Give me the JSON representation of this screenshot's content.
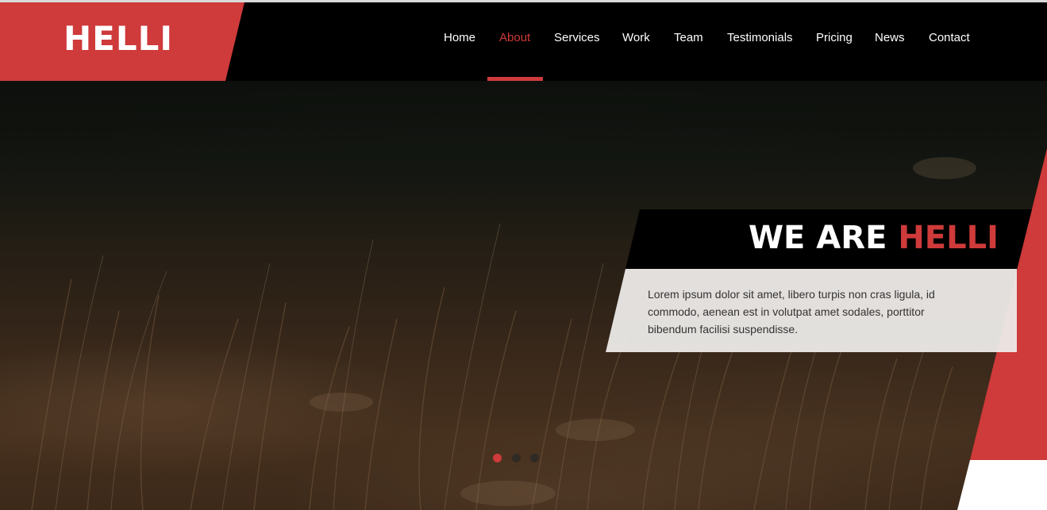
{
  "brand": {
    "logo_text": "HELLI",
    "accent_color": "#cf3a3a",
    "header_bg": "#000000"
  },
  "nav": {
    "items": [
      {
        "label": "Home",
        "active": false
      },
      {
        "label": "About",
        "active": true
      },
      {
        "label": "Services",
        "active": false
      },
      {
        "label": "Work",
        "active": false
      },
      {
        "label": "Team",
        "active": false
      },
      {
        "label": "Testimonials",
        "active": false
      },
      {
        "label": "Pricing",
        "active": false
      },
      {
        "label": "News",
        "active": false
      },
      {
        "label": "Contact",
        "active": false
      }
    ]
  },
  "hero": {
    "title_prefix": "WE ARE",
    "title_accent": "HELLI",
    "description": "Lorem ipsum dolor sit amet, libero turpis non cras ligula, id commodo, aenean est in volutpat amet sodales, porttitor bibendum facilisi suspendisse.",
    "slides": {
      "count": 3,
      "active_index": 0
    }
  }
}
